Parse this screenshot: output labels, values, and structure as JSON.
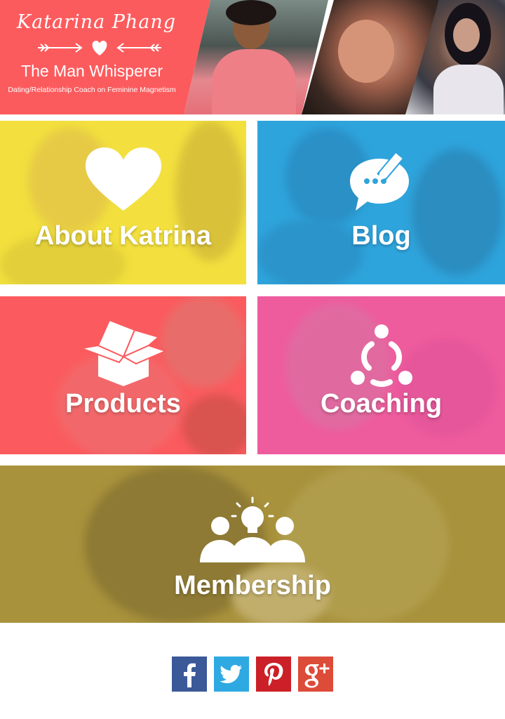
{
  "header": {
    "brand_name": "Katarina Phang",
    "title": "The Man Whisperer",
    "tagline": "Dating/Relationship Coach on Feminine Magnetism",
    "brand_color": "#fc5b5d"
  },
  "tiles": [
    {
      "id": "about",
      "label": "About Katrina",
      "icon": "heart-icon",
      "color": "#f5e23a"
    },
    {
      "id": "blog",
      "label": "Blog",
      "icon": "speech-bubble-pencil-icon",
      "color": "#2aa5de"
    },
    {
      "id": "products",
      "label": "Products",
      "icon": "open-box-icon",
      "color": "#fc5b5d"
    },
    {
      "id": "coaching",
      "label": "Coaching",
      "icon": "people-circle-icon",
      "color": "#f05e9e"
    },
    {
      "id": "membership",
      "label": "Membership",
      "icon": "team-lightbulb-icon",
      "color": "#a8923a"
    }
  ],
  "social": [
    {
      "name": "Facebook",
      "icon": "facebook-icon",
      "color": "#3b5998"
    },
    {
      "name": "Twitter",
      "icon": "twitter-icon",
      "color": "#2fa9e1"
    },
    {
      "name": "Pinterest",
      "icon": "pinterest-icon",
      "color": "#cb2027"
    },
    {
      "name": "Google+",
      "icon": "google-plus-icon",
      "color": "#dd4b39"
    }
  ]
}
